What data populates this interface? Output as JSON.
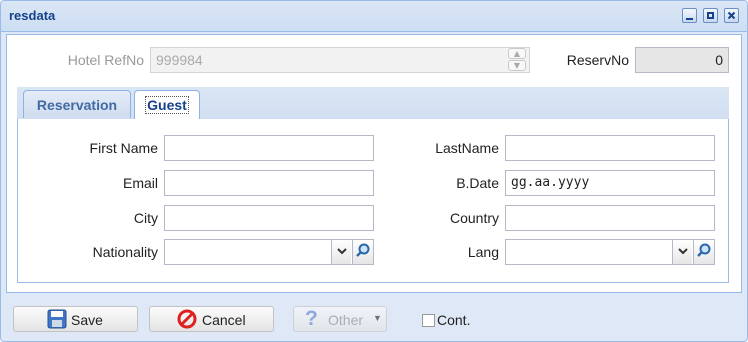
{
  "window": {
    "title": "resdata",
    "controls": [
      "minimize-icon",
      "maximize-icon",
      "close-icon"
    ]
  },
  "header": {
    "hotel_refno_label": "Hotel RefNo",
    "hotel_refno_value": "999984",
    "reservno_label": "ReservNo",
    "reservno_value": "0"
  },
  "tabs": [
    {
      "label": "Reservation",
      "active": false
    },
    {
      "label": "Guest",
      "active": true
    }
  ],
  "guest": {
    "first_name_label": "First Name",
    "first_name_value": "",
    "lastname_label": "LastName",
    "lastname_value": "",
    "email_label": "Email",
    "email_value": "",
    "bdate_label": "B.Date",
    "bdate_value": "gg.aa.yyyy",
    "city_label": "City",
    "city_value": "",
    "country_label": "Country",
    "country_value": "",
    "nationality_label": "Nationality",
    "nationality_value": "",
    "lang_label": "Lang",
    "lang_value": ""
  },
  "footer": {
    "save_label": "Save",
    "cancel_label": "Cancel",
    "other_label": "Other",
    "cont_label": "Cont.",
    "cont_checked": false
  },
  "colors": {
    "title_text": "#15428b",
    "window_bg": "#dfe8f6",
    "border": "#99bbe8",
    "cancel_icon": "#e02020"
  }
}
